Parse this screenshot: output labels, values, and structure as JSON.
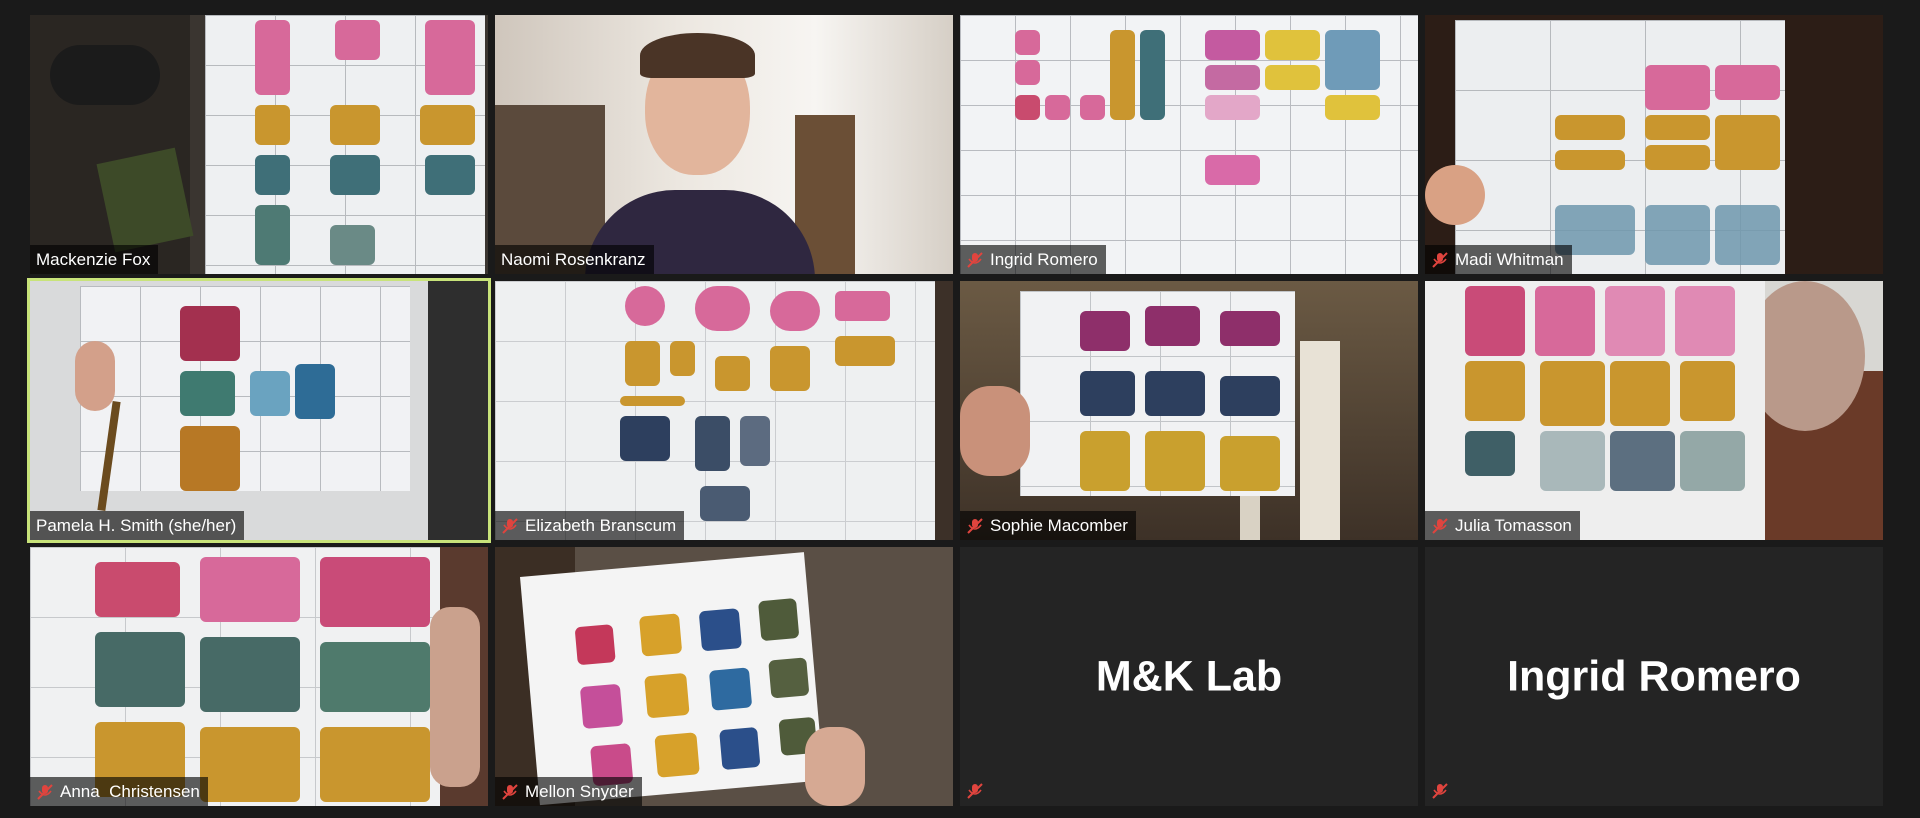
{
  "meeting": {
    "participants": [
      {
        "name": "Mackenzie Fox",
        "muted": false,
        "active_speaker": false
      },
      {
        "name": "Naomi Rosenkranz",
        "muted": false,
        "active_speaker": false
      },
      {
        "name": "Ingrid Romero",
        "muted": true,
        "active_speaker": false
      },
      {
        "name": "Madi Whitman",
        "muted": true,
        "active_speaker": false
      },
      {
        "name": "Pamela H. Smith (she/her)",
        "muted": false,
        "active_speaker": true
      },
      {
        "name": "Elizabeth Branscum",
        "muted": true,
        "active_speaker": false
      },
      {
        "name": "Sophie Macomber",
        "muted": true,
        "active_speaker": false
      },
      {
        "name": "Julia Tomasson",
        "muted": true,
        "active_speaker": false
      },
      {
        "name": "Anna  Christensen",
        "muted": true,
        "active_speaker": false
      },
      {
        "name": "Mellon Snyder",
        "muted": true,
        "active_speaker": false
      },
      {
        "name": "M&K Lab",
        "muted": true,
        "video_off": true
      },
      {
        "name": "Ingrid Romero",
        "muted": true,
        "video_off": true
      }
    ]
  },
  "colors": {
    "background": "#1a1a1a",
    "active_border": "#c8e37a",
    "muted_icon": "#e0443e",
    "pink": "#d7699a",
    "ochre": "#c9962e",
    "teal": "#3f6f78",
    "navy": "#2d3f5e",
    "crimson": "#c4385a"
  },
  "icons": {
    "muted": "microphone-muted-icon"
  }
}
